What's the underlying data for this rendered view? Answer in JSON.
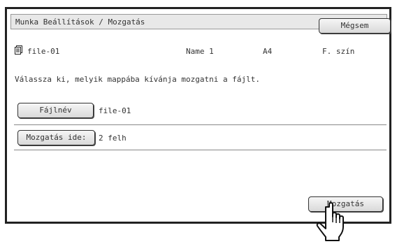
{
  "header": {
    "title": "Munka Beállítások / Mozgatás",
    "cancel_label": "Mégsem"
  },
  "file": {
    "icon": "file-icon",
    "name": "file-01",
    "user": "Name 1",
    "paper": "A4",
    "color_mode": "F. szín"
  },
  "instruction": "Válassza ki, melyik mappába kívánja mozgatni a fájlt.",
  "fields": {
    "filename_label": "Fájlnév",
    "filename_value": "file-01",
    "move_to_label": "Mozgatás ide:",
    "move_to_value": "2 felh"
  },
  "actions": {
    "move_label": "Mozgatás"
  },
  "cursor": {
    "icon": "pointing-hand-icon"
  }
}
